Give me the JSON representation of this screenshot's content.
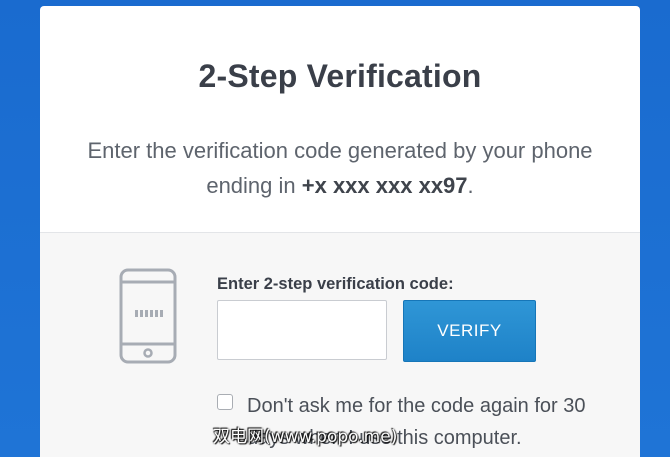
{
  "colors": {
    "page_background": "#1c6ed0",
    "card_background": "#ffffff",
    "lower_panel_background": "#f7f7f7",
    "button_primary": "#2589cd",
    "title_text": "#3a3f49"
  },
  "verification": {
    "title": "2-Step Verification",
    "description_prefix": "Enter the verification code generated by your phone ending in ",
    "phone_number": "+x xxx xxx xx97",
    "description_suffix": "."
  },
  "form": {
    "phone_icon": "smartphone-icon",
    "code_label": "Enter 2-step verification code:",
    "code_value": "",
    "verify_button_label": "VERIFY",
    "remember_checked": false,
    "remember_label": "Don't ask me for the code again for 30 days when I use this computer."
  },
  "watermark": {
    "text": "双电网(www.popo.me)"
  }
}
